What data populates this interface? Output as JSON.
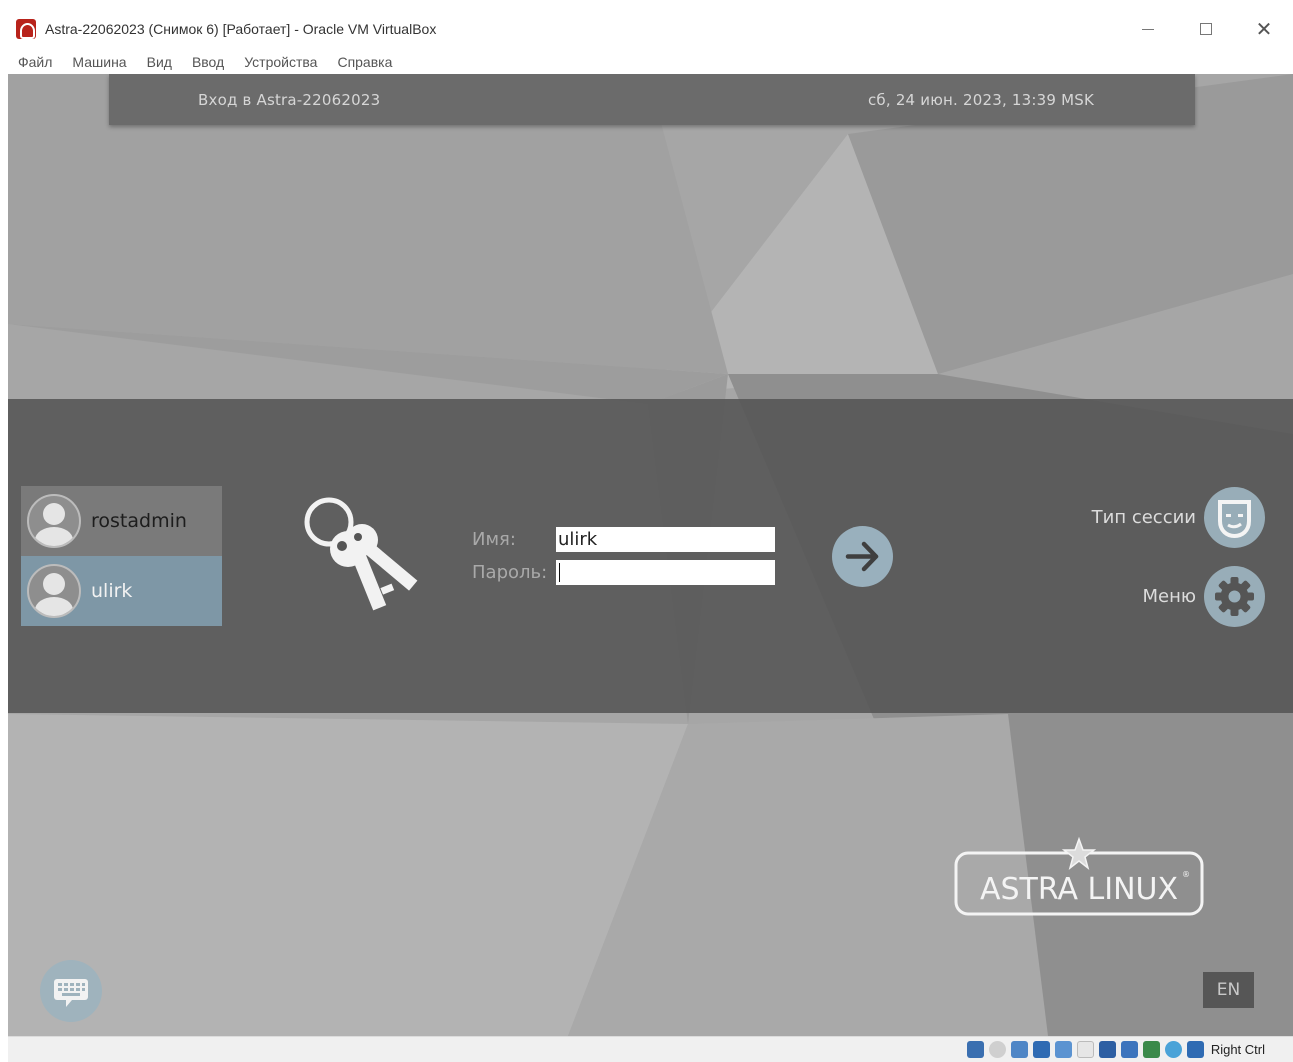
{
  "window": {
    "title": "Astra-22062023 (Снимок 6) [Работает] - Oracle VM VirtualBox",
    "controls": {
      "minimize": "—",
      "maximize": "☐",
      "close": "✕"
    }
  },
  "menubar": {
    "items": [
      {
        "label": "Файл"
      },
      {
        "label": "Машина"
      },
      {
        "label": "Вид"
      },
      {
        "label": "Ввод"
      },
      {
        "label": "Устройства"
      },
      {
        "label": "Справка"
      }
    ]
  },
  "greeter": {
    "host_label": "Вход в Astra-22062023",
    "clock": "сб, 24 июн. 2023, 13:39 MSK",
    "users": [
      {
        "name": "rostadmin",
        "selected": false
      },
      {
        "name": "ulirk",
        "selected": true
      }
    ],
    "name_label": "Имя:",
    "name_value": "ulirk",
    "password_label": "Пароль:",
    "password_value": "",
    "session_label": "Тип сессии",
    "menu_label": "Меню",
    "logo_text": "ASTRA LINUX",
    "language": "EN",
    "colors": {
      "band": "#555555",
      "selected_user": "#7e97a6",
      "accent_button": "#99b0bd"
    }
  },
  "statusbar": {
    "host_key": "Right Ctrl",
    "icons": [
      "hdd-icon",
      "optical-icon",
      "audio-icon",
      "network-icon",
      "usb-icon",
      "shared-folder-icon",
      "display-icon",
      "video-capture-icon",
      "guest-additions-icon",
      "mouse-integration-icon",
      "keyboard-capture-icon"
    ]
  }
}
